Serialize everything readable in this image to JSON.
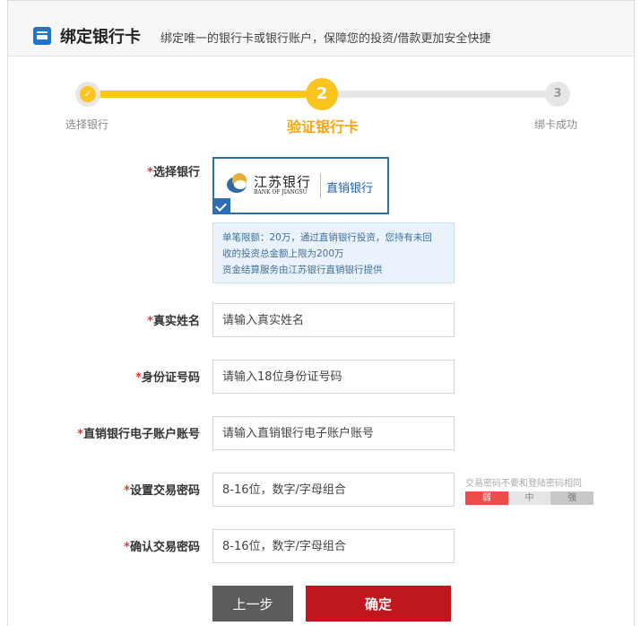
{
  "header": {
    "title": "绑定银行卡",
    "subtitle": "绑定唯一的银行卡或银行账户，保障您的投资/借款更加安全快捷"
  },
  "steps": {
    "current": 2,
    "items": [
      {
        "number": "✓",
        "label": "选择银行",
        "state": "done"
      },
      {
        "number": "2",
        "label": "验证银行卡",
        "state": "active"
      },
      {
        "number": "3",
        "label": "绑卡成功",
        "state": "todo"
      }
    ]
  },
  "colors": {
    "accent": "#fcc41f",
    "active_label": "#f5a70f",
    "primary_button": "#c0161d",
    "secondary_button": "#5c5c5c",
    "selected_border": "#2e6db4",
    "required": "#e03a3a"
  },
  "form": {
    "required_mark": "*",
    "bank": {
      "label": "选择银行",
      "selected": true,
      "bank_name_cn": "江苏银行",
      "bank_name_en": "BANK OF JIANGSU",
      "tag": "直销银行",
      "info_lines": [
        "单笔限额：20万，通过直销银行投资，您持有未回",
        "收的投资总金额上限为200万",
        "资金结算服务由江苏银行直销银行提供"
      ]
    },
    "real_name": {
      "label": "真实姓名",
      "placeholder": "请输入真实姓名",
      "value": ""
    },
    "id_number": {
      "label": "身份证号码",
      "placeholder": "请输入18位身份证号码",
      "value": ""
    },
    "account": {
      "label": "直销银行电子账户账号",
      "placeholder": "请输入直销银行电子账户账号",
      "value": ""
    },
    "password": {
      "label": "设置交易密码",
      "placeholder": "8-16位，数字/字母组合",
      "value": "",
      "hint": "交易密码不要和登陆密码相同",
      "strength_labels": [
        "弱",
        "中",
        "强"
      ],
      "strength": "弱"
    },
    "confirm_password": {
      "label": "确认交易密码",
      "placeholder": "8-16位，数字/字母组合",
      "value": ""
    }
  },
  "actions": {
    "back_label": "上一步",
    "confirm_label": "确定"
  }
}
